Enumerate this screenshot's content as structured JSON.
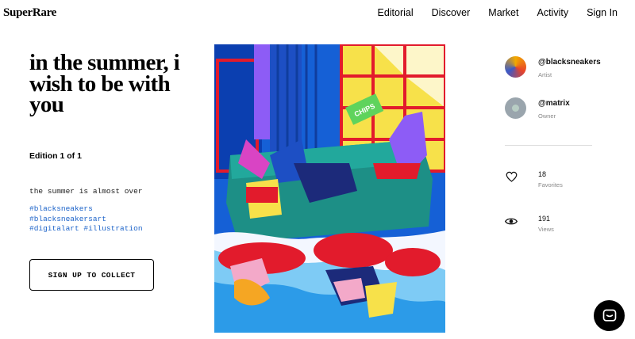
{
  "brand": {
    "logo": "SuperRare"
  },
  "nav": {
    "items": [
      "Editorial",
      "Discover",
      "Market",
      "Activity",
      "Sign In"
    ]
  },
  "artwork": {
    "title": "in the summer, i wish to be with you",
    "edition": "Edition 1 of 1",
    "description": "the summer is almost over",
    "tags": [
      "#blacksneakers",
      "#blacksneakersart",
      "#digitalart #illustration"
    ],
    "image_text": "CHIPS"
  },
  "cta": {
    "label": "SIGN UP TO COLLECT"
  },
  "people": {
    "artist": {
      "handle": "@blacksneakers",
      "role": "Artist"
    },
    "owner": {
      "handle": "@matrix",
      "role": "Owner"
    }
  },
  "stats": {
    "favorites": {
      "count": "18",
      "label": "Favorites",
      "icon": "heart-icon"
    },
    "views": {
      "count": "191",
      "label": "Views",
      "icon": "eye-icon"
    }
  },
  "chat": {
    "icon": "chat-icon"
  },
  "colors": {
    "link": "#1c63c9",
    "muted": "#888888",
    "button_border": "#000000"
  }
}
